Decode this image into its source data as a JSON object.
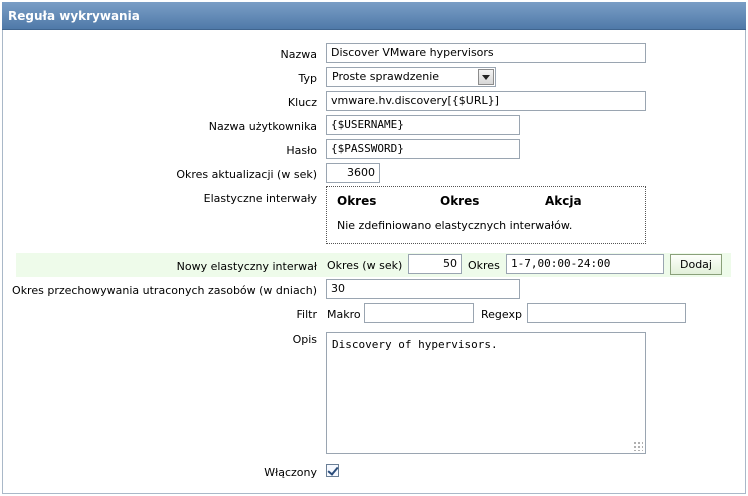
{
  "header": {
    "title": "Reguła wykrywania"
  },
  "form": {
    "name": {
      "label": "Nazwa",
      "value": "Discover VMware hypervisors"
    },
    "type": {
      "label": "Typ",
      "value": "Proste sprawdzenie"
    },
    "key": {
      "label": "Klucz",
      "value": "vmware.hv.discovery[{$URL}]"
    },
    "username": {
      "label": "Nazwa użytkownika",
      "value": "{$USERNAME}"
    },
    "password": {
      "label": "Hasło",
      "value": "{$PASSWORD}"
    },
    "update_interval": {
      "label": "Okres aktualizacji (w sek)",
      "value": "3600"
    },
    "flexible": {
      "label": "Elastyczne interwały",
      "headers": [
        "Okres",
        "Okres",
        "Akcja"
      ],
      "empty_text": "Nie zdefiniowano elastycznych interwałów."
    },
    "new_flexible": {
      "label": "Nowy elastyczny interwał",
      "interval_label": "Okres (w sek)",
      "interval_value": "50",
      "period_label": "Okres",
      "period_value": "1-7,00:00-24:00",
      "add_button": "Dodaj"
    },
    "keep_lost": {
      "label": "Okres przechowywania utraconych zasobów (w dniach)",
      "value": "30"
    },
    "filter": {
      "label": "Filtr",
      "macro_label": "Makro",
      "macro_value": "",
      "regexp_label": "Regexp",
      "regexp_value": ""
    },
    "description": {
      "label": "Opis",
      "value": "Discovery of hypervisors."
    },
    "enabled": {
      "label": "Włączony",
      "checked": true
    }
  },
  "colors": {
    "header": "#5a83b0",
    "highlight_row": "#eefbea"
  }
}
